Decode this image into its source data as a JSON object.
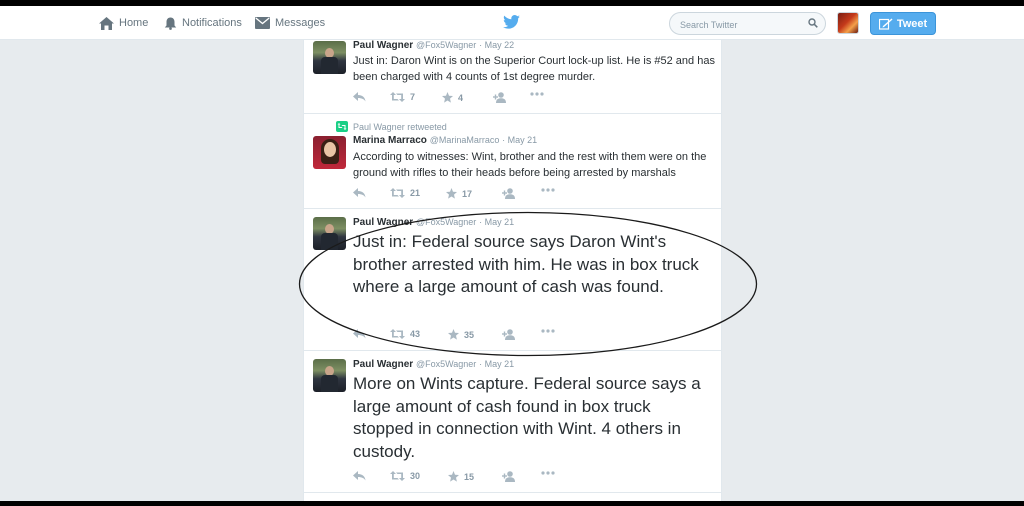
{
  "nav": {
    "home_label": "Home",
    "notifications_label": "Notifications",
    "messages_label": "Messages"
  },
  "search": {
    "placeholder": "Search Twitter"
  },
  "tweet_button": {
    "label": "Tweet"
  },
  "colors": {
    "brand": "#55acee",
    "annotation_oval": "#1a1a1a"
  },
  "tweets": [
    {
      "name": "Paul Wagner",
      "handle": "@Fox5Wagner",
      "date": "· May 22",
      "text": "Just in: Daron Wint is on the Superior Court lock-up list. He is #52 and has been charged with 4 counts of 1st degree murder.",
      "retweets": "7",
      "favorites": "4"
    },
    {
      "context": "Paul Wagner retweeted",
      "name": "Marina Marraco",
      "handle": "@MarinaMarraco",
      "date": "· May 21",
      "text": "According to witnesses: Wint, brother and the rest with them were on the ground with rifles to their heads before being arrested by marshals",
      "retweets": "21",
      "favorites": "17"
    },
    {
      "name": "Paul Wagner",
      "handle": "@Fox5Wagner",
      "date": "· May 21",
      "text": "Just in: Federal source says Daron Wint's brother arrested with him. He was in box truck where a large amount of cash was found.",
      "retweets": "43",
      "favorites": "35"
    },
    {
      "name": "Paul Wagner",
      "handle": "@Fox5Wagner",
      "date": "· May 21",
      "text": "More on Wints capture. Federal source says a large amount of cash found in box truck stopped in connection with Wint. 4 others in custody.",
      "retweets": "30",
      "favorites": "15"
    }
  ]
}
